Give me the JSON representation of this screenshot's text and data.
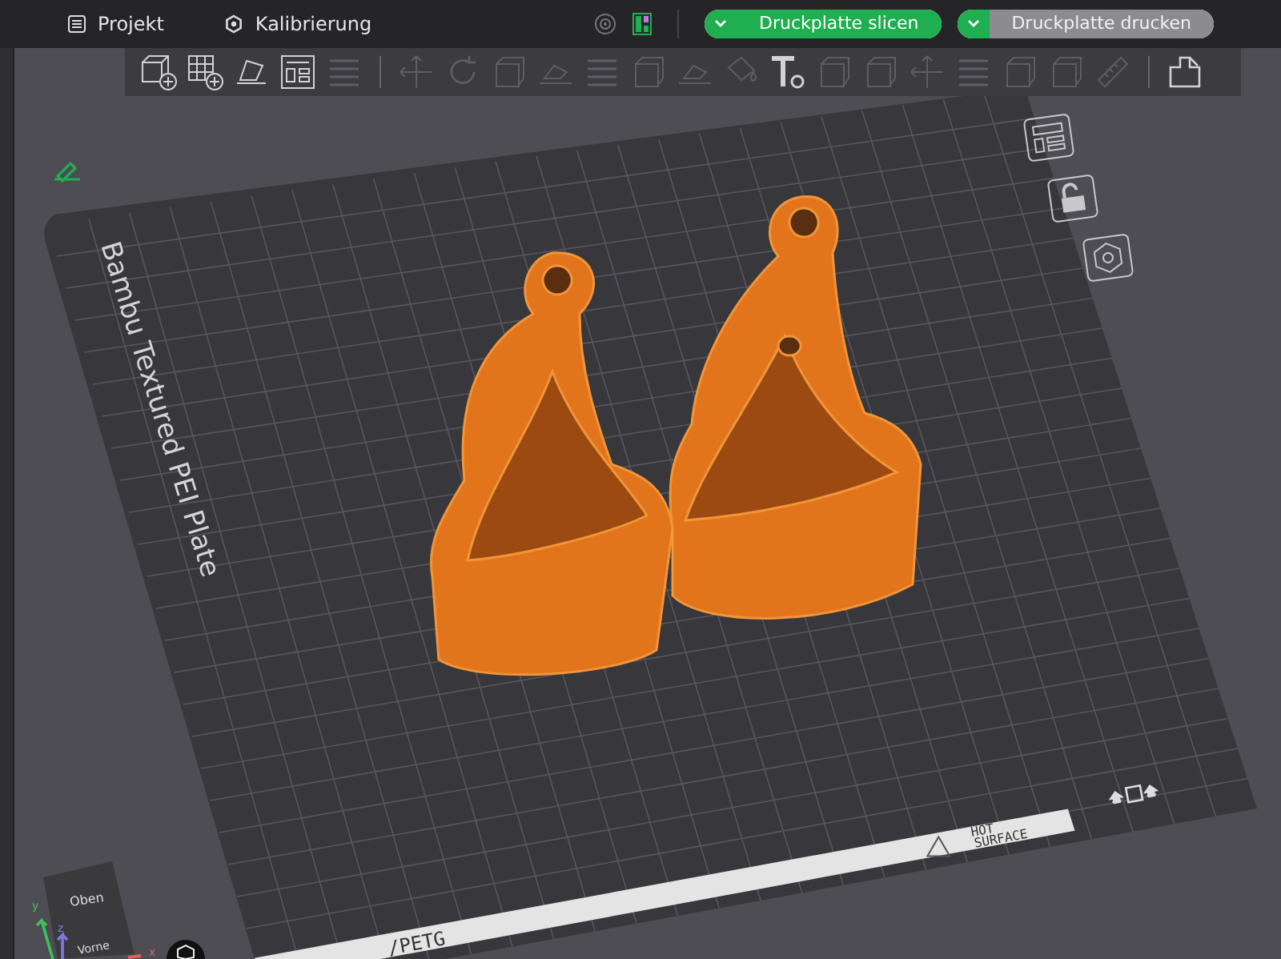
{
  "top_bar": {
    "menu": [
      {
        "label": "Projekt",
        "kind": "project"
      },
      {
        "label": "Kalibrierung",
        "kind": "calibration"
      }
    ],
    "actions": [
      {
        "label": "Druckplatte slicen",
        "disabled": false
      },
      {
        "label": "Druckplatte drucken",
        "disabled": true
      }
    ]
  },
  "toolbar": [
    {
      "kind": "add",
      "disabled": false
    },
    {
      "kind": "plate",
      "disabled": false
    },
    {
      "kind": "orient",
      "disabled": false
    },
    {
      "kind": "arrange",
      "disabled": false
    },
    {
      "kind": "layers",
      "disabled": true
    },
    {
      "kind": "separator"
    },
    {
      "kind": "move",
      "disabled": true
    },
    {
      "kind": "rotate",
      "disabled": true
    },
    {
      "kind": "box",
      "disabled": true
    },
    {
      "kind": "lay",
      "disabled": true
    },
    {
      "kind": "layers",
      "disabled": true
    },
    {
      "kind": "box",
      "disabled": true
    },
    {
      "kind": "lay",
      "disabled": true
    },
    {
      "kind": "paint",
      "disabled": true
    },
    {
      "kind": "text",
      "disabled": false
    },
    {
      "kind": "box",
      "disabled": true
    },
    {
      "kind": "box",
      "disabled": true
    },
    {
      "kind": "move",
      "disabled": true
    },
    {
      "kind": "layers",
      "disabled": true
    },
    {
      "kind": "box",
      "disabled": true
    },
    {
      "kind": "box",
      "disabled": true
    },
    {
      "kind": "measure",
      "disabled": true
    },
    {
      "kind": "separator"
    },
    {
      "kind": "assembly",
      "disabled": false
    }
  ],
  "plate": {
    "name": "Bambu Textured PEI Plate",
    "edge_labels": [
      "/PETG",
      "HOT",
      "SURFACE"
    ]
  },
  "side_tools": [
    {
      "kind": "layout"
    },
    {
      "kind": "lock"
    },
    {
      "kind": "nut"
    }
  ],
  "view_cube": {
    "faces": [
      "Oben",
      "Vorne"
    ],
    "axes": [
      "y",
      "z",
      "x"
    ]
  }
}
